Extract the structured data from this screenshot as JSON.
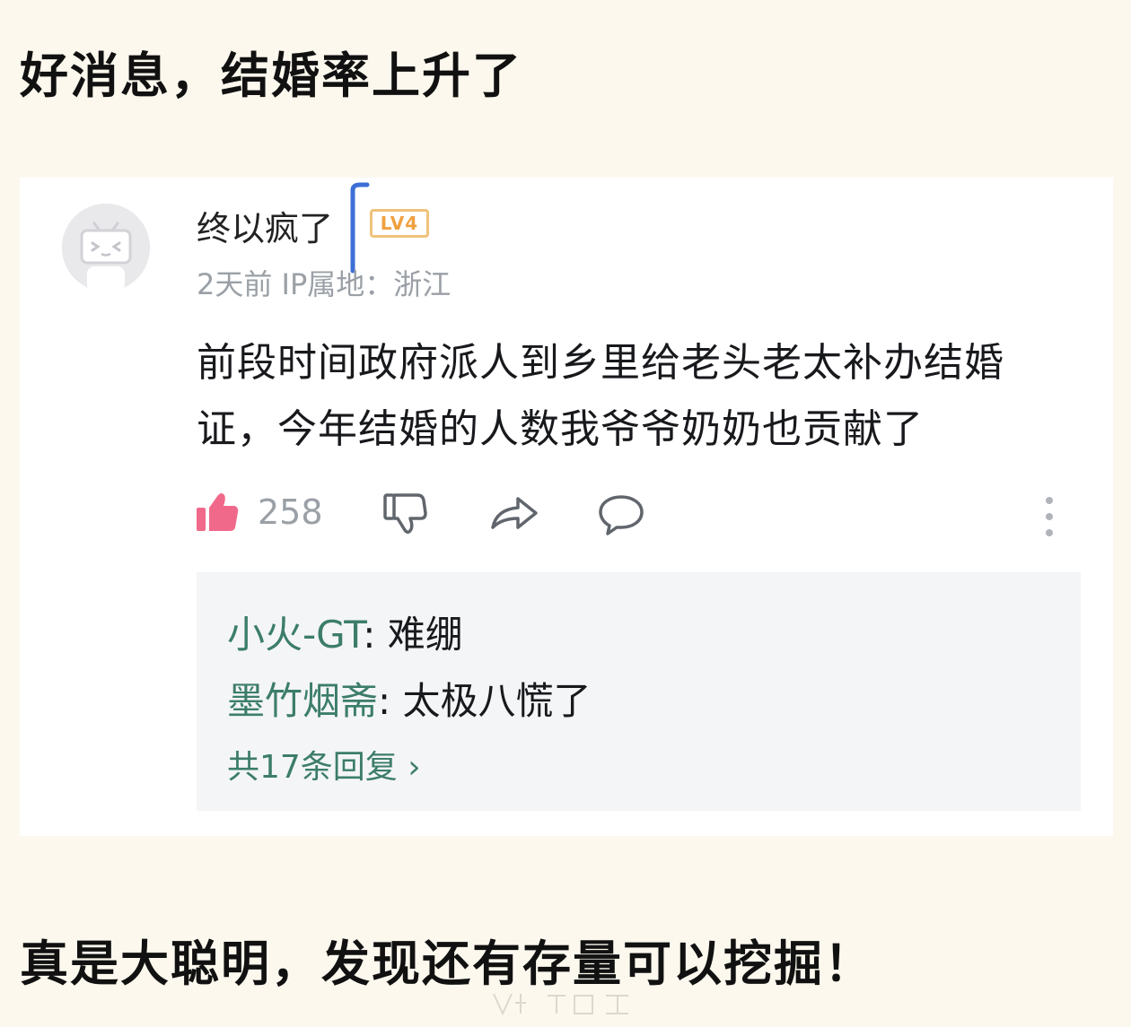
{
  "headline": "好消息，结婚率上升了",
  "comment": {
    "username": "终以疯了",
    "level": "LV4",
    "meta": "2天前 IP属地：浙江",
    "body": "前段时间政府派人到乡里给老头老太补办结婚证，今年结婚的人数我爷爷奶奶也贡献了",
    "like_count": "258",
    "icons": [
      "thumbs-up-icon",
      "thumbs-down-icon",
      "share-icon",
      "comment-icon",
      "more-icon"
    ]
  },
  "replies": [
    {
      "name": "小火-GT",
      "sep": ": ",
      "text": "难绷"
    },
    {
      "name": "墨竹烟斋",
      "sep": ": ",
      "text": "太极八慌了"
    }
  ],
  "more_replies": "共17条回复 ›",
  "footer": "真是大聪明，发现还有存量可以挖掘！",
  "colors": {
    "background": "#fcf8ee",
    "like": "#f0698a",
    "reply_name": "#3c7d6a",
    "level_badge": "#f0c27a"
  }
}
